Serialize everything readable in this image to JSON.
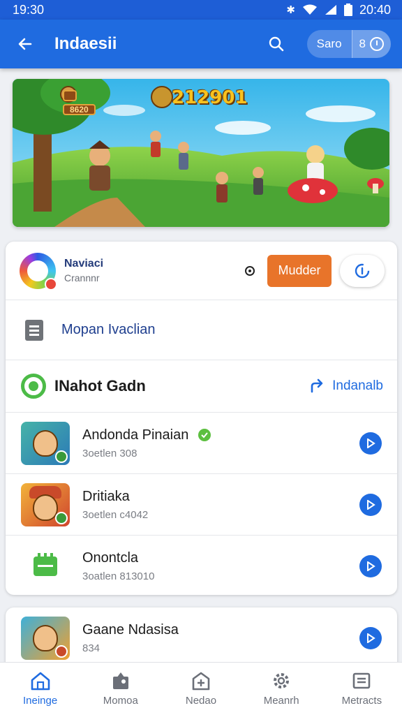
{
  "status_bar": {
    "time": "19:30",
    "right_time": "20:40"
  },
  "app_bar": {
    "title": "Indaesii",
    "pill_label": "Saro",
    "pill_value": "8"
  },
  "banner": {
    "score": "212901",
    "badge_top": "",
    "badge_bottom": "8620"
  },
  "card": {
    "app_name": "Naviaci",
    "app_sub": "Crannnr",
    "orange_button": "Mudder",
    "doc_label": "Mopan Ivaclian",
    "section_title": "INahot Gadn",
    "section_link": "Indanalb",
    "items": [
      {
        "title": "Andonda Pinaian",
        "sub": "3oetlen 308"
      },
      {
        "title": "Dritiaka",
        "sub": "3oetlen c4042"
      },
      {
        "title": "Onontcla",
        "sub": "3oatlen 813010"
      }
    ]
  },
  "card2": {
    "title": "Gaane Ndasisa",
    "sub": "834"
  },
  "bottom_nav": [
    {
      "label": "Ineinge",
      "icon": "home-icon"
    },
    {
      "label": "Momoa",
      "icon": "tools-icon"
    },
    {
      "label": "Nedao",
      "icon": "store-icon"
    },
    {
      "label": "Meanrh",
      "icon": "gear-icon"
    },
    {
      "label": "Metracts",
      "icon": "list-icon"
    }
  ],
  "colors": {
    "primary": "#1f6be0",
    "accent_orange": "#e8742a",
    "green": "#4cbb47"
  }
}
